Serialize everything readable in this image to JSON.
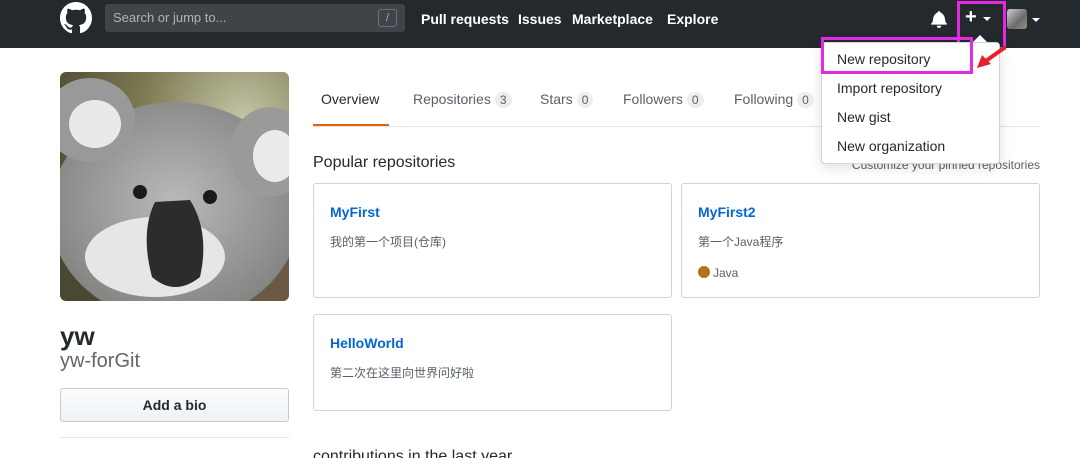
{
  "header": {
    "search_placeholder": "Search or jump to...",
    "search_shortcut": "/",
    "nav": [
      "Pull requests",
      "Issues",
      "Marketplace",
      "Explore"
    ],
    "plus_icon": "+"
  },
  "dropdown": {
    "items": [
      "New repository",
      "Import repository",
      "New gist",
      "New organization"
    ],
    "highlight_color": "#e22ae0"
  },
  "profile": {
    "name": "yw",
    "login": "yw-forGit",
    "bio_button": "Add a bio"
  },
  "tabs": [
    {
      "label": "Overview"
    },
    {
      "label": "Repositories",
      "count": "3"
    },
    {
      "label": "Stars",
      "count": "0"
    },
    {
      "label": "Followers",
      "count": "0"
    },
    {
      "label": "Following",
      "count": "0"
    }
  ],
  "main": {
    "popular_title": "Popular repositories",
    "customize_link": "Customize your pinned repositories",
    "repos": [
      {
        "name": "MyFirst",
        "description": "我的第一个项目(仓库)"
      },
      {
        "name": "MyFirst2",
        "description": "第一个Java程序",
        "language": "Java",
        "language_color": "#b07219"
      },
      {
        "name": "HelloWorld",
        "description": "第二次在这里向世界问好啦"
      }
    ],
    "contributions_partial": "contributions in the last year"
  },
  "colors": {
    "header_bg": "#24292e",
    "link": "#0366d6",
    "tab_accent": "#e36209",
    "annotation_arrow": "#e8202a"
  }
}
